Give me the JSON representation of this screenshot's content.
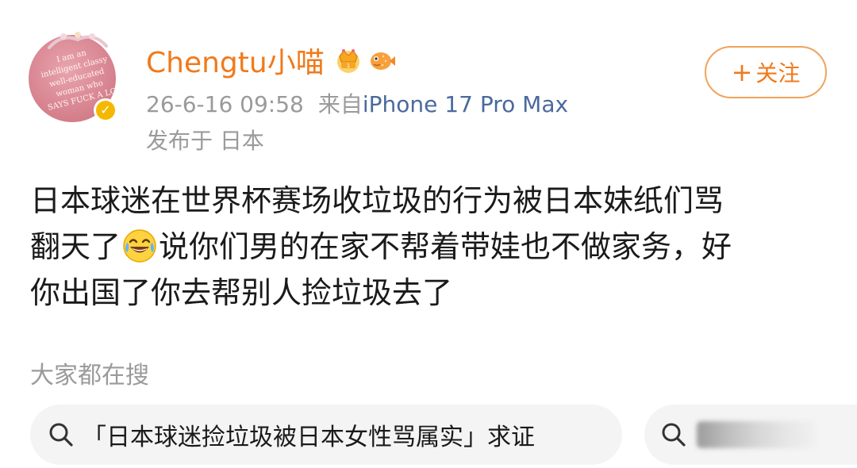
{
  "post": {
    "author": {
      "name": "Chengtu小喵",
      "avatar_text": [
        "I am an",
        "intelligent classy",
        "well-educated",
        "woman who",
        "SAYS FUCK A LO"
      ],
      "verified_icon": "verified-v-badge",
      "badges": [
        "crown-badge-icon",
        "pufferfish-badge-icon"
      ]
    },
    "timestamp": "26-6-16 09:58",
    "source_prefix": "来自",
    "source_device": "iPhone 17 Pro Max",
    "location": "发布于 日本",
    "follow_button": {
      "plus": "+",
      "label": "关注"
    },
    "content": {
      "line1": "日本球迷在世界杯赛场收垃圾的行为被日本妹纸们骂",
      "line2_start": "翻天了",
      "emoji": "laughing-crying-emoji",
      "line2_end": "说你们男的在家不帮着带娃也不做家务，好",
      "line3": "你出国了你去帮别人捡垃圾去了"
    }
  },
  "search": {
    "title": "大家都在搜",
    "chips": [
      {
        "label": "「日本球迷捡垃圾被日本女性骂属实」求证",
        "icon": "search-icon"
      },
      {
        "label": "",
        "icon": "search-icon",
        "blurred": true
      }
    ]
  },
  "colors": {
    "username": "#f07a1b",
    "follow_border": "#f1a35d",
    "meta_gray": "#9a9a9a",
    "device_blue": "#4a6a9c",
    "chip_bg": "#f4f4f4",
    "verified_gold": "#f5b800"
  }
}
